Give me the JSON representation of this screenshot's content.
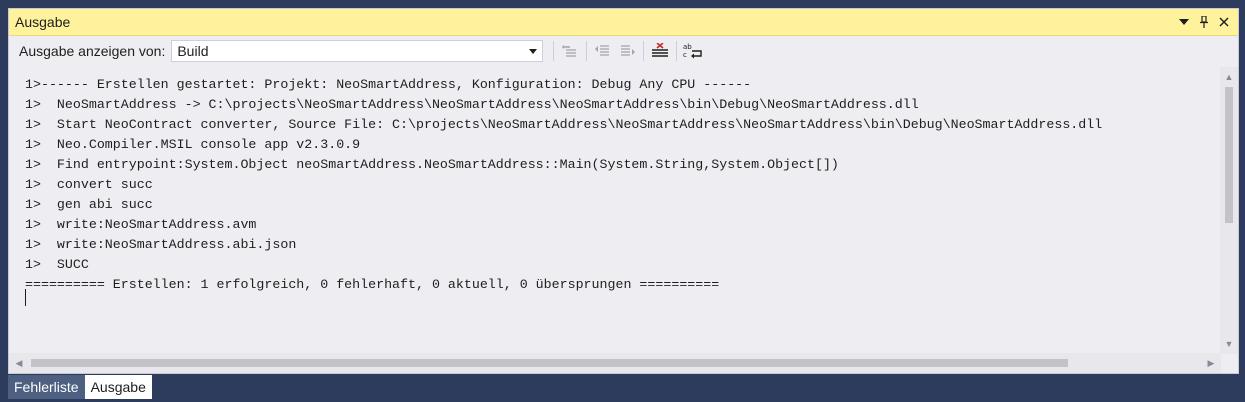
{
  "window": {
    "title": "Ausgabe",
    "controls": {
      "menu_icon": "dropdown-arrow-icon",
      "pin_icon": "pin-icon",
      "close_icon": "close-icon"
    }
  },
  "toolbar": {
    "show_output_label": "Ausgabe anzeigen von:",
    "source_value": "Build",
    "tools": [
      {
        "name": "go-to-previous-message-icon",
        "enabled": false
      },
      {
        "name": "find-previous-icon",
        "enabled": false
      },
      {
        "name": "find-next-icon",
        "enabled": false
      },
      {
        "name": "clear-all-icon",
        "enabled": true
      },
      {
        "name": "toggle-word-wrap-icon",
        "enabled": true
      }
    ]
  },
  "output": {
    "lines": [
      "1>------ Erstellen gestartet: Projekt: NeoSmartAddress, Konfiguration: Debug Any CPU ------",
      "1>  NeoSmartAddress -> C:\\projects\\NeoSmartAddress\\NeoSmartAddress\\NeoSmartAddress\\bin\\Debug\\NeoSmartAddress.dll",
      "1>  Start NeoContract converter, Source File: C:\\projects\\NeoSmartAddress\\NeoSmartAddress\\NeoSmartAddress\\bin\\Debug\\NeoSmartAddress.dll",
      "1>  Neo.Compiler.MSIL console app v2.3.0.9",
      "1>  Find entrypoint:System.Object neoSmartAddress.NeoSmartAddress::Main(System.String,System.Object[])",
      "1>  convert succ",
      "1>  gen abi succ",
      "1>  write:NeoSmartAddress.avm",
      "1>  write:NeoSmartAddress.abi.json",
      "1>  SUCC",
      "========== Erstellen: 1 erfolgreich, 0 fehlerhaft, 0 aktuell, 0 übersprungen =========="
    ]
  },
  "tabs": [
    {
      "label": "Fehlerliste",
      "active": false
    },
    {
      "label": "Ausgabe",
      "active": true
    }
  ],
  "colors": {
    "title_bar": "#fff29d",
    "panel_bg": "#eeeef2",
    "outer_bg": "#2d3b5c",
    "inactive_tab": "#4d6082"
  }
}
